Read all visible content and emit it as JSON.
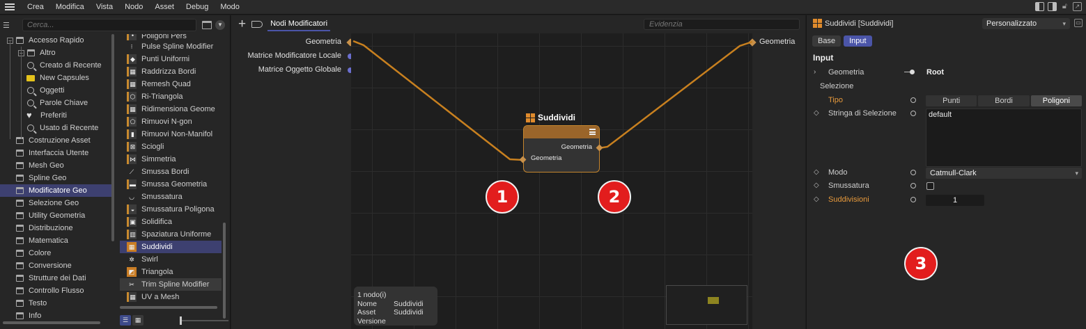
{
  "menubar": {
    "items": [
      "Crea",
      "Modifica",
      "Vista",
      "Nodo",
      "Asset",
      "Debug",
      "Modo"
    ]
  },
  "left": {
    "search_placeholder": "Cerca...",
    "tree": [
      {
        "label": "Accesso Rapido",
        "icon": "folder-icon",
        "level": 0,
        "expand": "−"
      },
      {
        "label": "Altro",
        "icon": "folder-icon",
        "level": 1,
        "expand": "+"
      },
      {
        "label": "Creato di Recente",
        "icon": "search-icon",
        "level": 1
      },
      {
        "label": "New Capsules",
        "icon": "tag-icon",
        "level": 1
      },
      {
        "label": "Oggetti",
        "icon": "search-icon",
        "level": 1
      },
      {
        "label": "Parole Chiave",
        "icon": "search-icon",
        "level": 1
      },
      {
        "label": "Preferiti",
        "icon": "heart-icon",
        "level": 1
      },
      {
        "label": "Usato di Recente",
        "icon": "search-icon",
        "level": 1
      },
      {
        "label": "Costruzione Asset",
        "icon": "folder-icon",
        "level": 0
      },
      {
        "label": "Interfaccia Utente",
        "icon": "folder-icon",
        "level": 0
      },
      {
        "label": "Mesh Geo",
        "icon": "folder-icon",
        "level": 0
      },
      {
        "label": "Spline Geo",
        "icon": "folder-icon",
        "level": 0
      },
      {
        "label": "Modificatore Geo",
        "icon": "folder-icon",
        "level": 0,
        "selected": true
      },
      {
        "label": "Selezione Geo",
        "icon": "folder-icon",
        "level": 0
      },
      {
        "label": "Utility Geometria",
        "icon": "folder-icon",
        "level": 0
      },
      {
        "label": "Distribuzione",
        "icon": "folder-icon",
        "level": 0
      },
      {
        "label": "Matematica",
        "icon": "folder-icon",
        "level": 0
      },
      {
        "label": "Colore",
        "icon": "folder-icon",
        "level": 0
      },
      {
        "label": "Conversione",
        "icon": "folder-icon",
        "level": 0
      },
      {
        "label": "Strutture dei Dati",
        "icon": "folder-icon",
        "level": 0
      },
      {
        "label": "Controllo Flusso",
        "icon": "folder-icon",
        "level": 0
      },
      {
        "label": "Testo",
        "icon": "folder-icon",
        "level": 0
      },
      {
        "label": "Info",
        "icon": "folder-icon",
        "level": 0
      }
    ],
    "assets": [
      {
        "label": "Poligoni Pers",
        "icon": "•",
        "cut": true
      },
      {
        "label": "Pulse Spline Modifier",
        "icon": "⁝",
        "style": "plain"
      },
      {
        "label": "Punti Uniformi",
        "icon": "◆"
      },
      {
        "label": "Raddrizza Bordi",
        "icon": "▦"
      },
      {
        "label": "Remesh Quad",
        "icon": "▦"
      },
      {
        "label": "Ri-Triangola",
        "icon": "⬡"
      },
      {
        "label": "Ridimensiona Geome",
        "icon": "▦"
      },
      {
        "label": "Rimuovi N-gon",
        "icon": "⬠"
      },
      {
        "label": "Rimuovi Non-Manifol",
        "icon": "▮"
      },
      {
        "label": "Sciogli",
        "icon": "⊠"
      },
      {
        "label": "Simmetria",
        "icon": "⋈"
      },
      {
        "label": "Smussa Bordi",
        "icon": "⟋",
        "style": "plain"
      },
      {
        "label": "Smussa Geometria",
        "icon": "▬"
      },
      {
        "label": "Smussatura",
        "icon": "◡",
        "style": "plain"
      },
      {
        "label": "Smussatura Poligona",
        "icon": "◒"
      },
      {
        "label": "Solidifica",
        "icon": "▣"
      },
      {
        "label": "Spaziatura Uniforme",
        "icon": "▥"
      },
      {
        "label": "Suddividi",
        "icon": "▦",
        "style": "orange",
        "selected": true
      },
      {
        "label": "Swirl",
        "icon": "✲",
        "style": "plain"
      },
      {
        "label": "Triangola",
        "icon": "◩",
        "style": "orange"
      },
      {
        "label": "Trim Spline Modifier",
        "icon": "✂",
        "style": "plain",
        "hover": true
      },
      {
        "label": "UV a Mesh",
        "icon": "▦"
      }
    ]
  },
  "editor": {
    "tab": "Nodi Modificatori",
    "search_placeholder": "Evidenzia",
    "left_ports": [
      "Geometria",
      "Matrice Modificatore Locale",
      "Matrice Oggetto Globale"
    ],
    "right_port": "Geometria",
    "node": {
      "title": "Suddividi",
      "output": "Geometria",
      "input": "Geometria"
    },
    "badges": [
      "1",
      "2",
      "3"
    ],
    "info": [
      {
        "k": "1 nodo(i)",
        "v": ""
      },
      {
        "k": "Nome",
        "v": "Suddividi"
      },
      {
        "k": "Asset",
        "v": "Suddividi"
      },
      {
        "k": "Versione",
        "v": ""
      }
    ],
    "wire_color": "#c8801f"
  },
  "attr": {
    "title": "Suddividi [Suddividi]",
    "mode": "Personalizzato",
    "tabs": [
      "Base",
      "Input"
    ],
    "section": "Input",
    "geometria": {
      "label": "Geometria",
      "value": "Root"
    },
    "selezione": "Selezione",
    "tipo": {
      "label": "Tipo",
      "options": [
        "Punti",
        "Bordi",
        "Poligoni"
      ],
      "selected": "Poligoni"
    },
    "stringa": {
      "label": "Stringa di Selezione",
      "value": "default"
    },
    "modo": {
      "label": "Modo",
      "value": "Catmull-Clark"
    },
    "smussatura": {
      "label": "Smussatura",
      "checked": false
    },
    "suddivisioni": {
      "label": "Suddivisioni",
      "value": "1"
    }
  }
}
